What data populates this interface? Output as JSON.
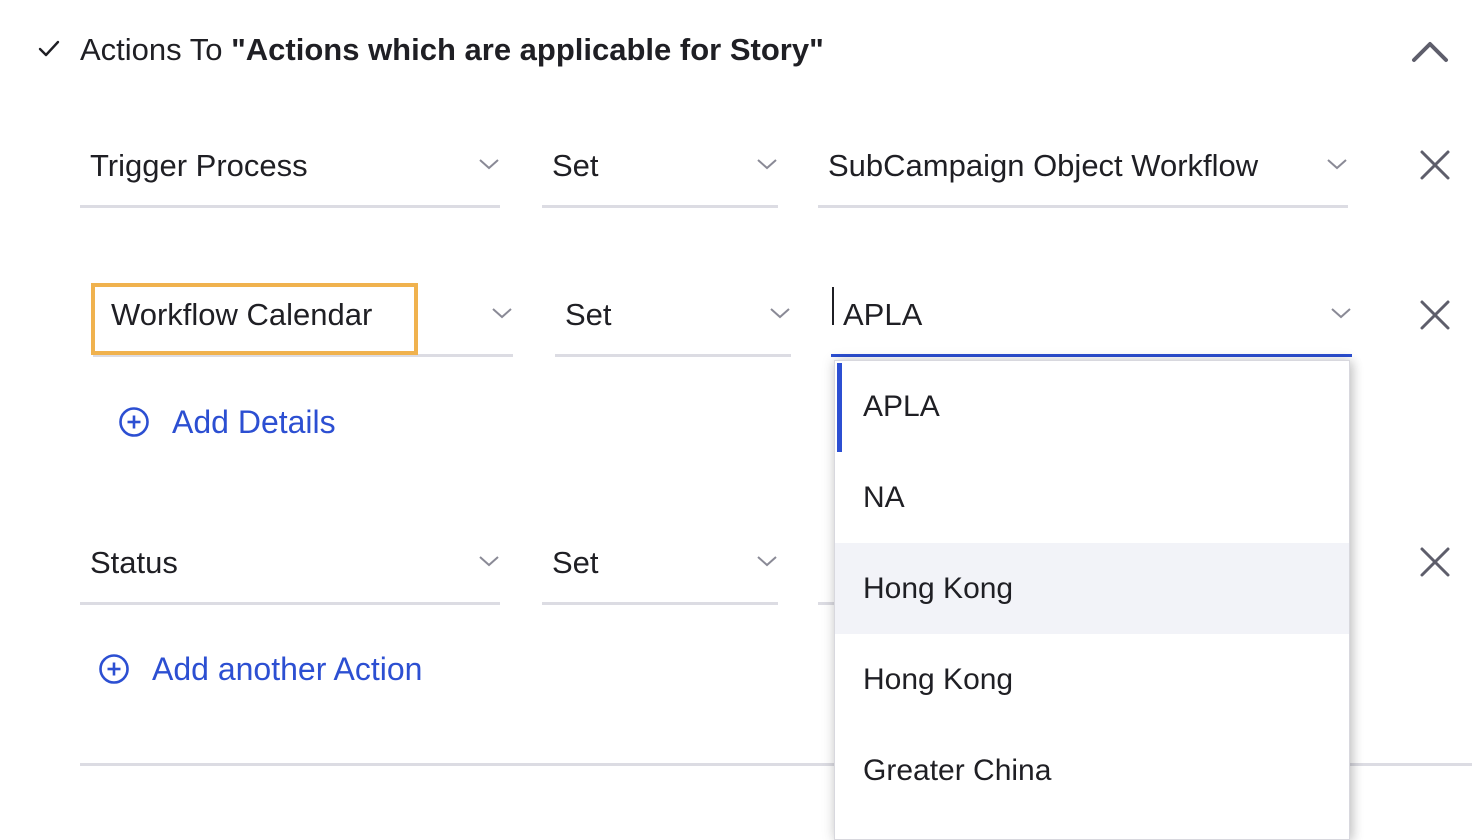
{
  "header": {
    "prefix": "Actions To ",
    "title": "\"Actions which are applicable for Story\"",
    "check_icon": "checkmark-icon",
    "collapse_icon": "chevron-up-icon"
  },
  "actions": [
    {
      "field": "Trigger Process",
      "operator": "Set",
      "value": "SubCampaign Object Workflow"
    },
    {
      "field": "Workflow Calendar",
      "operator": "Set",
      "value": "APLA",
      "highlighted": true,
      "add_details_label": "Add Details"
    },
    {
      "field": "Status",
      "operator": "Set",
      "value": ""
    }
  ],
  "add_action_label": "Add another Action",
  "dropdown": {
    "options": [
      "APLA",
      "NA",
      "Hong Kong",
      "Hong Kong",
      "Greater China"
    ],
    "selected_index": 0,
    "hovered_index": 2
  },
  "colors": {
    "accent": "#2c4fd2",
    "highlight": "#f0b24e",
    "underline": "#dcdce3",
    "hover_bg": "#f2f3f8",
    "icon_gray": "#6b6b78"
  }
}
